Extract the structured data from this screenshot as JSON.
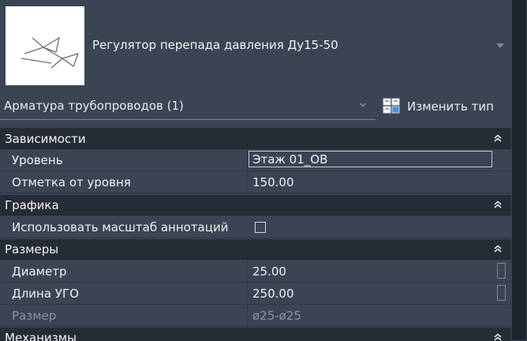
{
  "type_selector": {
    "family_name": "Регулятор перепада давления Ду15-50"
  },
  "category": {
    "label": "Арматура трубопроводов (1)"
  },
  "edit_type": {
    "label": "Изменить тип"
  },
  "groups": {
    "constraints": {
      "title": "Зависимости",
      "rows": [
        {
          "name": "Уровень",
          "value": "Этаж 01_OB"
        },
        {
          "name": "Отметка от уровня",
          "value": "150.00"
        }
      ]
    },
    "graphics": {
      "title": "Графика",
      "rows": [
        {
          "name": "Использовать масштаб аннотаций",
          "checked": false
        }
      ]
    },
    "dimensions": {
      "title": "Размеры",
      "rows": [
        {
          "name": "Диаметр",
          "value": "25.00"
        },
        {
          "name": "Длина УГО",
          "value": "250.00"
        },
        {
          "name": "Размер",
          "value": "ø25-ø25"
        }
      ]
    },
    "mechanical": {
      "title": "Механизмы"
    }
  },
  "colors": {
    "panel_bg": "#3b4453",
    "group_header_bg": "#262c36",
    "text": "#e9ecef",
    "disabled_text": "#8a93a1"
  }
}
